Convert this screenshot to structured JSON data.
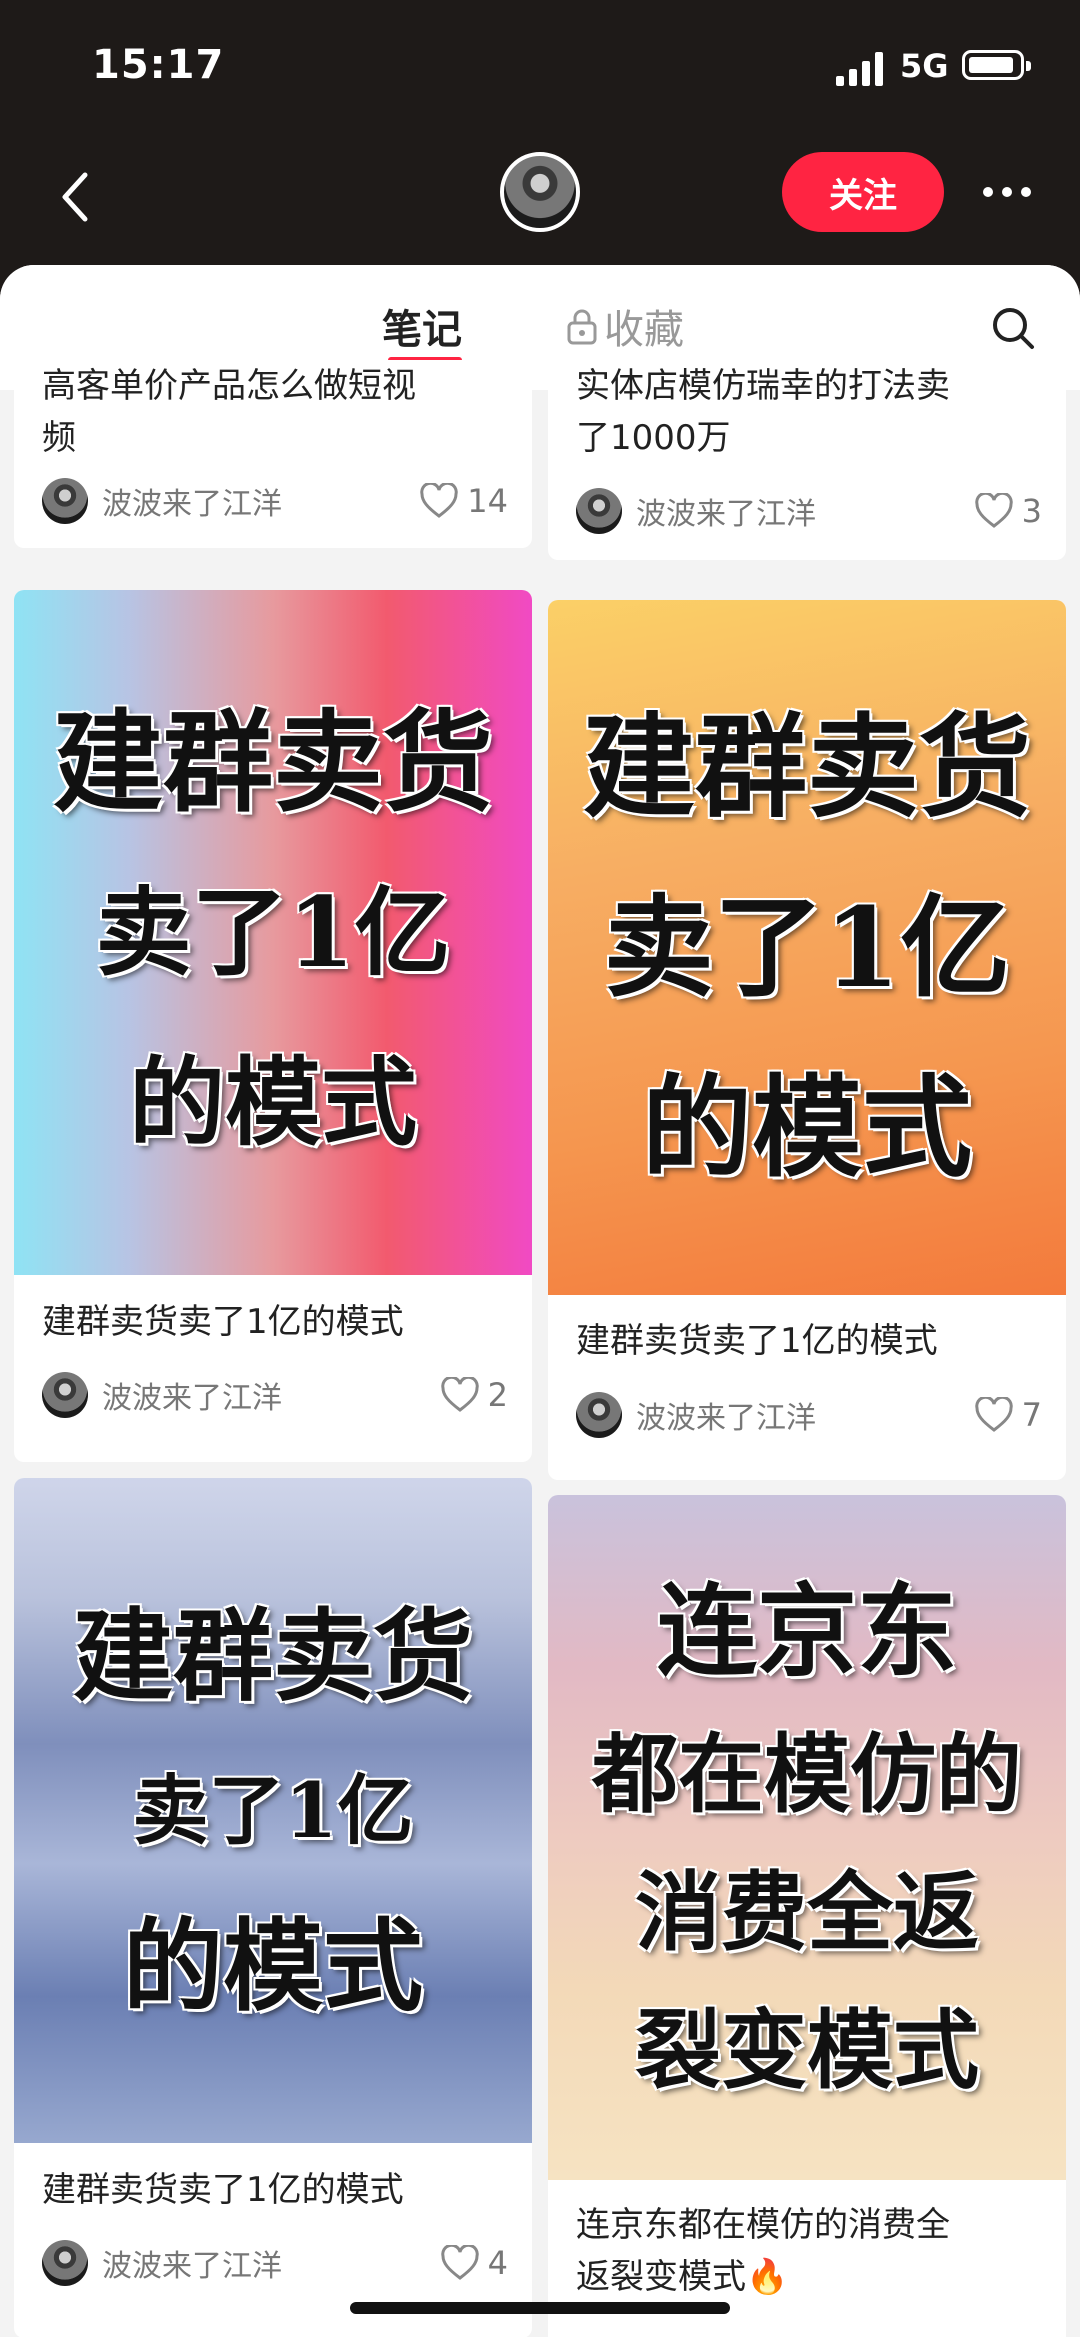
{
  "status_bar": {
    "time": "15:17",
    "network": "5G"
  },
  "header": {
    "follow_label": "关注"
  },
  "tabs": {
    "notes": "笔记",
    "collections": "收藏"
  },
  "cards": [
    {
      "title_lines": [
        "高客单价产品怎么做短视",
        "频"
      ],
      "author": "波波来了江洋",
      "likes": "14"
    },
    {
      "title_lines": [
        "实体店模仿瑞幸的打法卖",
        "了1000万"
      ],
      "author": "波波来了江洋",
      "likes": "3"
    },
    {
      "cover_lines": [
        "建群卖货",
        "卖了1亿",
        "的模式"
      ],
      "title_lines": [
        "建群卖货卖了1亿的模式"
      ],
      "author": "波波来了江洋",
      "likes": "2"
    },
    {
      "cover_lines": [
        "建群卖货",
        "卖了1亿",
        "的模式"
      ],
      "title_lines": [
        "建群卖货卖了1亿的模式"
      ],
      "author": "波波来了江洋",
      "likes": "7"
    },
    {
      "cover_lines": [
        "建群卖货",
        "卖了1亿",
        "的模式"
      ],
      "title_lines": [
        "建群卖货卖了1亿的模式"
      ],
      "author": "波波来了江洋",
      "likes": "4"
    },
    {
      "cover_lines": [
        "连京东",
        "都在模仿的",
        "消费全返",
        "裂变模式"
      ],
      "title_lines": [
        "连京东都在模仿的消费全",
        "返裂变模式🔥"
      ]
    }
  ],
  "colors": {
    "accent": "#ff2442",
    "header_bg": "#1e1a18"
  }
}
